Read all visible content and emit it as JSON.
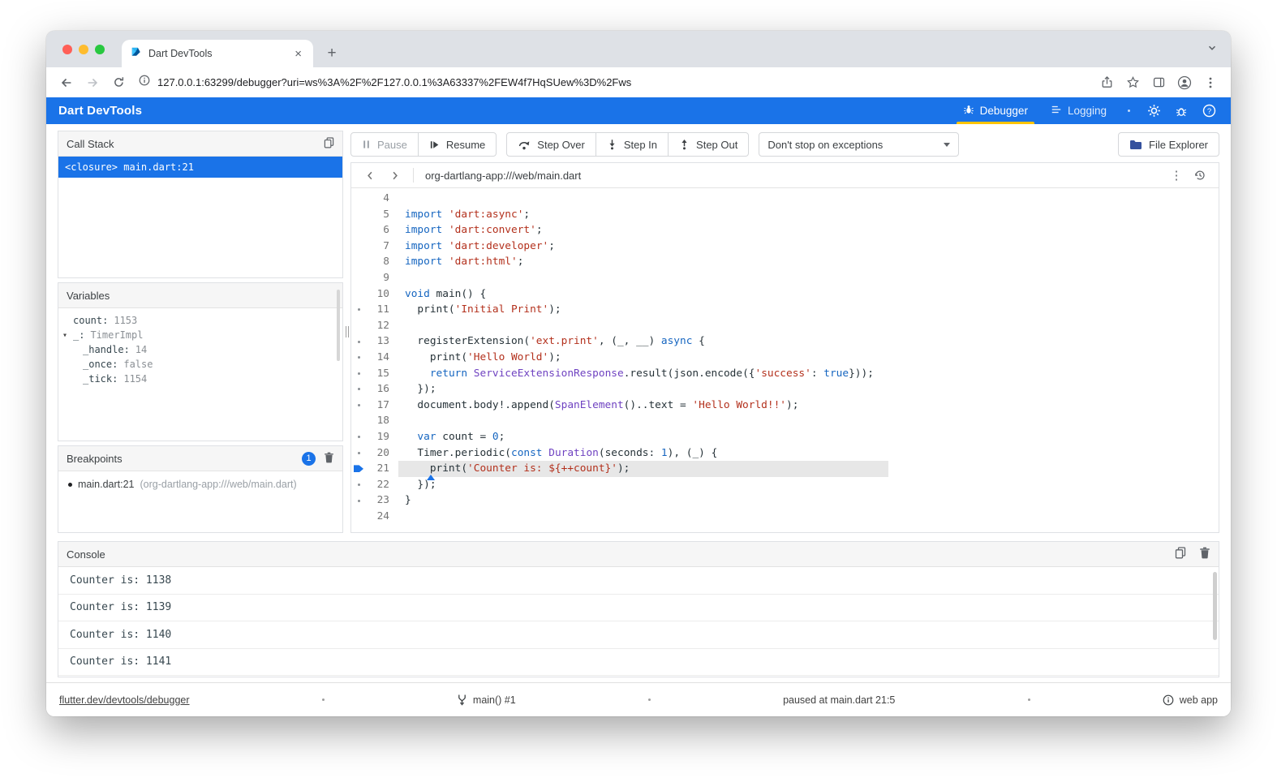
{
  "browser": {
    "tab": {
      "title": "Dart DevTools"
    },
    "url": "127.0.0.1:63299/debugger?uri=ws%3A%2F%2F127.0.0.1%3A63337%2FEW4f7HqSUew%3D%2Fws"
  },
  "app_bar": {
    "title": "Dart DevTools",
    "tab_debugger": "Debugger",
    "tab_logging": "Logging"
  },
  "call_stack": {
    "title": "Call Stack",
    "frames": [
      {
        "label": "<closure> main.dart:21",
        "selected": true
      }
    ]
  },
  "variables": {
    "title": "Variables",
    "items": [
      {
        "name": "count:",
        "value": "1153",
        "indent": 0,
        "expander": false
      },
      {
        "name": "_:",
        "value": "TimerImpl",
        "indent": 0,
        "expander": true
      },
      {
        "name": "_handle:",
        "value": "14",
        "indent": 1,
        "expander": false
      },
      {
        "name": "_once:",
        "value": "false",
        "indent": 1,
        "expander": false
      },
      {
        "name": "_tick:",
        "value": "1154",
        "indent": 1,
        "expander": false
      }
    ]
  },
  "breakpoints": {
    "title": "Breakpoints",
    "badge": "1",
    "items": [
      {
        "location": "main.dart:21",
        "path": "(org-dartlang-app:///web/main.dart)"
      }
    ]
  },
  "toolbar": {
    "pause": "Pause",
    "resume": "Resume",
    "step_over": "Step Over",
    "step_in": "Step In",
    "step_out": "Step Out",
    "exceptions_dropdown": "Don't stop on exceptions",
    "file_explorer": "File Explorer"
  },
  "editor": {
    "file_path": "org-dartlang-app:///web/main.dart",
    "lines": [
      {
        "n": 4,
        "tokens": []
      },
      {
        "n": 5,
        "tokens": [
          [
            "kw",
            "import"
          ],
          [
            "pl",
            " "
          ],
          [
            "str",
            "'dart:async'"
          ],
          [
            "pl",
            ";"
          ]
        ]
      },
      {
        "n": 6,
        "tokens": [
          [
            "kw",
            "import"
          ],
          [
            "pl",
            " "
          ],
          [
            "str",
            "'dart:convert'"
          ],
          [
            "pl",
            ";"
          ]
        ]
      },
      {
        "n": 7,
        "tokens": [
          [
            "kw",
            "import"
          ],
          [
            "pl",
            " "
          ],
          [
            "str",
            "'dart:developer'"
          ],
          [
            "pl",
            ";"
          ]
        ]
      },
      {
        "n": 8,
        "tokens": [
          [
            "kw",
            "import"
          ],
          [
            "pl",
            " "
          ],
          [
            "str",
            "'dart:html'"
          ],
          [
            "pl",
            ";"
          ]
        ]
      },
      {
        "n": 9,
        "tokens": []
      },
      {
        "n": 10,
        "tokens": [
          [
            "kw",
            "void"
          ],
          [
            "pl",
            " main() {"
          ]
        ]
      },
      {
        "n": 11,
        "dot": true,
        "tokens": [
          [
            "pl",
            "  print("
          ],
          [
            "str",
            "'Initial Print'"
          ],
          [
            "pl",
            ");"
          ]
        ]
      },
      {
        "n": 12,
        "tokens": []
      },
      {
        "n": 13,
        "dot": true,
        "tokens": [
          [
            "pl",
            "  registerExtension("
          ],
          [
            "str",
            "'ext.print'"
          ],
          [
            "pl",
            ", (_, __) "
          ],
          [
            "kw",
            "async"
          ],
          [
            "pl",
            " {"
          ]
        ]
      },
      {
        "n": 14,
        "dot": true,
        "tokens": [
          [
            "pl",
            "    print("
          ],
          [
            "str",
            "'Hello World'"
          ],
          [
            "pl",
            ");"
          ]
        ]
      },
      {
        "n": 15,
        "dot": true,
        "tokens": [
          [
            "pl",
            "    "
          ],
          [
            "kw",
            "return"
          ],
          [
            "pl",
            " "
          ],
          [
            "ty",
            "ServiceExtensionResponse"
          ],
          [
            "pl",
            ".result(json.encode({"
          ],
          [
            "str",
            "'success'"
          ],
          [
            "pl",
            ": "
          ],
          [
            "kw",
            "true"
          ],
          [
            "pl",
            "}));"
          ]
        ]
      },
      {
        "n": 16,
        "dot": true,
        "tokens": [
          [
            "pl",
            "  });"
          ]
        ]
      },
      {
        "n": 17,
        "dot": true,
        "tokens": [
          [
            "pl",
            "  document.body!.append("
          ],
          [
            "ty",
            "SpanElement"
          ],
          [
            "pl",
            "()..text = "
          ],
          [
            "str",
            "'Hello World!!'"
          ],
          [
            "pl",
            ");"
          ]
        ]
      },
      {
        "n": 18,
        "tokens": []
      },
      {
        "n": 19,
        "dot": true,
        "tokens": [
          [
            "pl",
            "  "
          ],
          [
            "kw",
            "var"
          ],
          [
            "pl",
            " count = "
          ],
          [
            "num",
            "0"
          ],
          [
            "pl",
            ";"
          ]
        ]
      },
      {
        "n": 20,
        "dot": true,
        "tokens": [
          [
            "pl",
            "  Timer.periodic("
          ],
          [
            "kw",
            "const"
          ],
          [
            "pl",
            " "
          ],
          [
            "ty",
            "Duration"
          ],
          [
            "pl",
            "(seconds: "
          ],
          [
            "num",
            "1"
          ],
          [
            "pl",
            "), (_) {"
          ]
        ]
      },
      {
        "n": 21,
        "bp": true,
        "hl": true,
        "caret": 4,
        "tokens": [
          [
            "pl",
            "    print("
          ],
          [
            "str",
            "'Counter is: ${++count}'"
          ],
          [
            "pl",
            ");"
          ]
        ]
      },
      {
        "n": 22,
        "dot": true,
        "tokens": [
          [
            "pl",
            "  });"
          ]
        ]
      },
      {
        "n": 23,
        "dot": true,
        "tokens": [
          [
            "pl",
            "}"
          ]
        ]
      },
      {
        "n": 24,
        "tokens": []
      }
    ]
  },
  "console": {
    "title": "Console",
    "lines": [
      "Counter is: 1138",
      "Counter is: 1139",
      "Counter is: 1140",
      "Counter is: 1141"
    ]
  },
  "footer": {
    "docs_link": "flutter.dev/devtools/debugger",
    "isolate": "main() #1",
    "status": "paused at main.dart 21:5",
    "app_kind": "web app"
  }
}
